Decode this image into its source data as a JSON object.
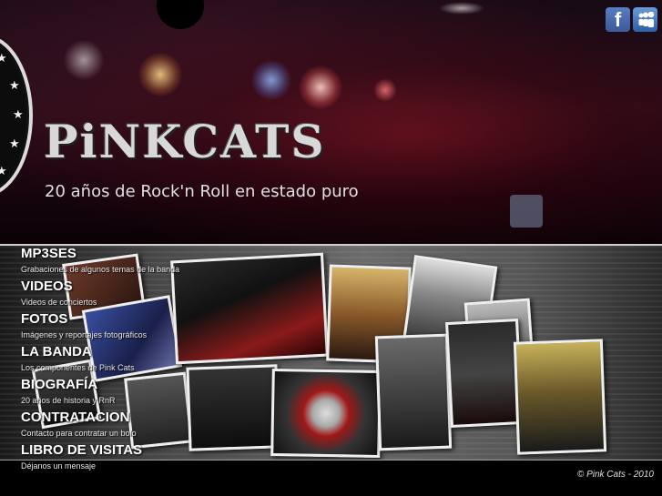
{
  "header": {
    "logo_text": "PiNKCATS",
    "tagline": "20 años de Rock'n Roll en estado puro"
  },
  "social": {
    "facebook_icon": "facebook-icon",
    "myspace_icon": "myspace-icon"
  },
  "nav": {
    "items": [
      {
        "title": "MP3SES",
        "subtitle": "Grabaciones de algunos temas de la banda"
      },
      {
        "title": "VIDEOS",
        "subtitle": "Videos de conciertos"
      },
      {
        "title": "FOTOS",
        "subtitle": "Imágenes y reportajes fotográficos"
      },
      {
        "title": "LA BANDA",
        "subtitle": "Los componentes de Pink Cats"
      },
      {
        "title": "BIOGRAFÍA",
        "subtitle": "20 años de historia y RnR"
      },
      {
        "title": "CONTRATACION",
        "subtitle": "Contacto para contratar un bolo"
      },
      {
        "title": "LIBRO DE VISITAS",
        "subtitle": "Déjanos un mensaje"
      }
    ]
  },
  "footer": {
    "copyright": "© Pink Cats - 2010"
  },
  "colors": {
    "background": "#000000",
    "text": "#ffffff",
    "facebook": "#3b5998",
    "myspace": "#2c5ea4"
  }
}
